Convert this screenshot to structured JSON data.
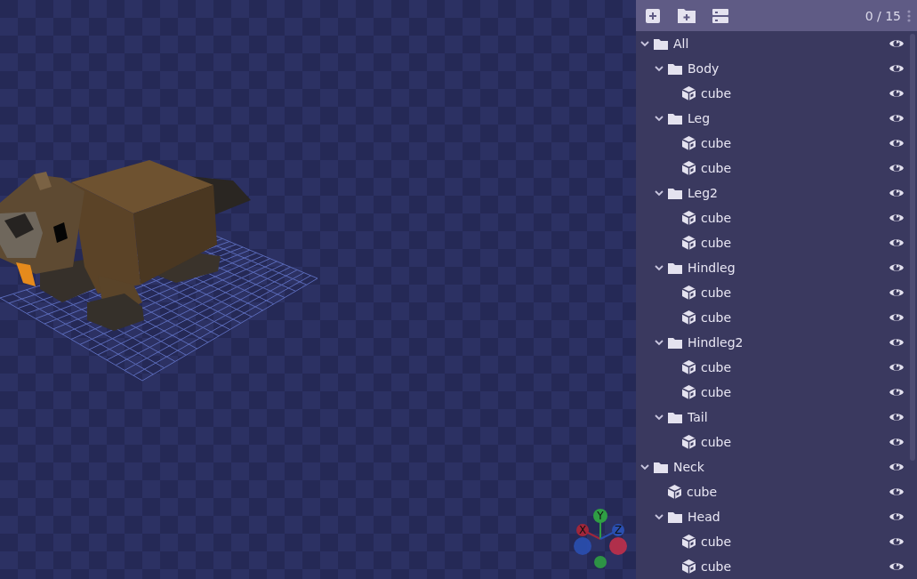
{
  "outliner": {
    "counter": "0 / 15",
    "nodes": [
      {
        "kind": "group",
        "name": "All",
        "expanded": true,
        "visible": true,
        "children": [
          {
            "kind": "group",
            "name": "Body",
            "expanded": true,
            "visible": true,
            "children": [
              {
                "kind": "cube",
                "name": "cube",
                "visible": true
              }
            ]
          },
          {
            "kind": "group",
            "name": "Leg",
            "expanded": true,
            "visible": true,
            "children": [
              {
                "kind": "cube",
                "name": "cube",
                "visible": true
              },
              {
                "kind": "cube",
                "name": "cube",
                "visible": true
              }
            ]
          },
          {
            "kind": "group",
            "name": "Leg2",
            "expanded": true,
            "visible": true,
            "children": [
              {
                "kind": "cube",
                "name": "cube",
                "visible": true
              },
              {
                "kind": "cube",
                "name": "cube",
                "visible": true
              }
            ]
          },
          {
            "kind": "group",
            "name": "Hindleg",
            "expanded": true,
            "visible": true,
            "children": [
              {
                "kind": "cube",
                "name": "cube",
                "visible": true
              },
              {
                "kind": "cube",
                "name": "cube",
                "visible": true
              }
            ]
          },
          {
            "kind": "group",
            "name": "Hindleg2",
            "expanded": true,
            "visible": true,
            "children": [
              {
                "kind": "cube",
                "name": "cube",
                "visible": true
              },
              {
                "kind": "cube",
                "name": "cube",
                "visible": true
              }
            ]
          },
          {
            "kind": "group",
            "name": "Tail",
            "expanded": true,
            "visible": true,
            "children": [
              {
                "kind": "cube",
                "name": "cube",
                "visible": true
              }
            ]
          }
        ]
      },
      {
        "kind": "group",
        "name": "Neck",
        "expanded": true,
        "visible": true,
        "children": [
          {
            "kind": "cube",
            "name": "cube",
            "visible": true
          },
          {
            "kind": "group",
            "name": "Head",
            "expanded": true,
            "visible": true,
            "children": [
              {
                "kind": "cube",
                "name": "cube",
                "visible": true
              },
              {
                "kind": "cube",
                "name": "cube",
                "visible": true
              }
            ]
          }
        ]
      }
    ]
  },
  "gizmo": {
    "axes": [
      {
        "label": "X",
        "color": "#a0263a"
      },
      {
        "label": "Y",
        "color": "#2f9e44"
      },
      {
        "label": "Z",
        "color": "#2a4fb0"
      }
    ]
  }
}
